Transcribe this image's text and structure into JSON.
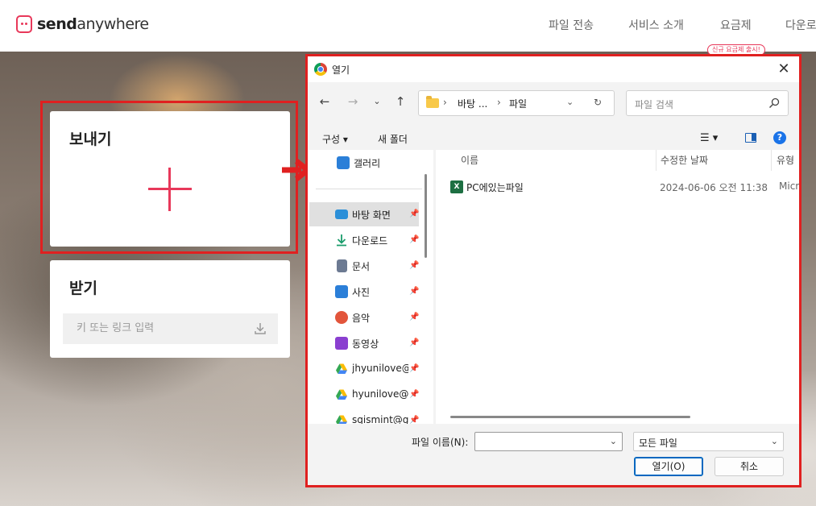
{
  "brand": {
    "bold": "send",
    "rest": "anywhere"
  },
  "nav": {
    "items": [
      "파일 전송",
      "서비스 소개",
      "요금제",
      "다운로드"
    ],
    "badge": "신규 요금제 출시!"
  },
  "send_card": {
    "title": "보내기"
  },
  "receive_card": {
    "title": "받기",
    "placeholder": "키 또는 링크 입력"
  },
  "dialog": {
    "title": "열기",
    "breadcrumb": [
      "바탕 ...",
      "파일"
    ],
    "search_placeholder": "파일 검색",
    "toolbar": {
      "organize": "구성",
      "new_folder": "새 폴더"
    },
    "sidebar": {
      "gallery": "갤러리",
      "items": [
        {
          "label": "바탕 화면",
          "icon": "desktop-icon",
          "color": "#2b8fd8",
          "selected": true
        },
        {
          "label": "다운로드",
          "icon": "download-icon",
          "color": "#1a9c6b"
        },
        {
          "label": "문서",
          "icon": "document-icon",
          "color": "#6c7a92"
        },
        {
          "label": "사진",
          "icon": "pictures-icon",
          "color": "#2b7fd8"
        },
        {
          "label": "음악",
          "icon": "music-icon",
          "color": "#e2553b"
        },
        {
          "label": "동영상",
          "icon": "video-icon",
          "color": "#8a3fd0"
        },
        {
          "label": "jhyunilove@gmail.com",
          "icon": "google-drive-icon",
          "color": "#34a853"
        },
        {
          "label": "hyunilove@gmail.com",
          "icon": "google-drive-icon",
          "color": "#34a853"
        },
        {
          "label": "sqismint@gmail.com",
          "icon": "google-drive-icon",
          "color": "#34a853"
        }
      ]
    },
    "columns": {
      "name": "이름",
      "modified": "수정한 날짜",
      "type": "유형"
    },
    "files": [
      {
        "name": "PC에있는파일",
        "modified": "2024-06-06 오전 11:38",
        "type": "Microsoft Excel"
      }
    ],
    "filename_label": "파일 이름(N):",
    "filename_value": "",
    "filetype": "모든 파일",
    "open_button": "열기(O)",
    "cancel_button": "취소"
  },
  "colors": {
    "accent": "#e8385a",
    "highlight": "#e02020",
    "primary_button_border": "#0067c0"
  }
}
